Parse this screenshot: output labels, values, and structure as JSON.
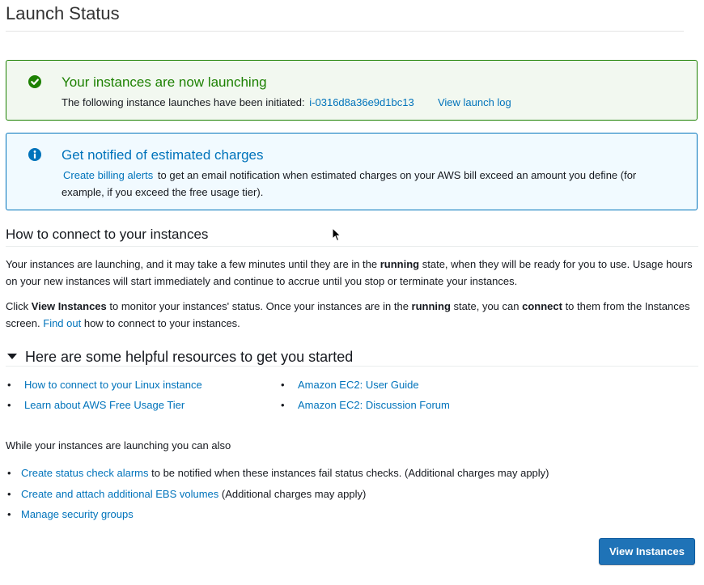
{
  "page": {
    "title": "Launch Status"
  },
  "success_alert": {
    "heading": "Your instances are now launching",
    "text": "The following instance launches have been initiated:",
    "instance_id": "i-0316d8a36e9d1bc13",
    "view_log": "View launch log",
    "icon": "check-circle-icon",
    "color": "#1d8102"
  },
  "info_alert": {
    "heading": "Get notified of estimated charges",
    "link": "Create billing alerts",
    "text": "to get an email notification when estimated charges on your AWS bill exceed an amount you define (for example, if you exceed the free usage tier).",
    "icon": "info-circle-icon",
    "color": "#0073bb"
  },
  "connect": {
    "title": "How to connect to your instances",
    "p1_a": "Your instances are launching, and it may take a few minutes until they are in the ",
    "p1_b": "running",
    "p1_c": " state, when they will be ready for you to use. Usage hours on your new instances will start immediately and continue to accrue until you stop or terminate your instances.",
    "p2_a": "Click ",
    "p2_b": "View Instances",
    "p2_c": " to monitor your instances' status. Once your instances are in the ",
    "p2_d": "running",
    "p2_e": " state, you can ",
    "p2_f": "connect",
    "p2_g": " to them from the Instances screen. ",
    "p2_link": "Find out",
    "p2_h": " how to connect to your instances."
  },
  "resources": {
    "title": "Here are some helpful resources to get you started",
    "left": [
      "How to connect to your Linux instance",
      "Learn about AWS Free Usage Tier"
    ],
    "right": [
      "Amazon EC2: User Guide",
      "Amazon EC2: Discussion Forum"
    ]
  },
  "also": {
    "intro": "While your instances are launching you can also",
    "items": [
      {
        "link": "Create status check alarms",
        "text": " to be notified when these instances fail status checks. (Additional charges may apply)"
      },
      {
        "link": "Create and attach additional EBS volumes",
        "text": " (Additional charges may apply)"
      },
      {
        "link": "Manage security groups",
        "text": ""
      }
    ]
  },
  "actions": {
    "view_instances": "View Instances",
    "primary_color": "#1f73b7"
  }
}
